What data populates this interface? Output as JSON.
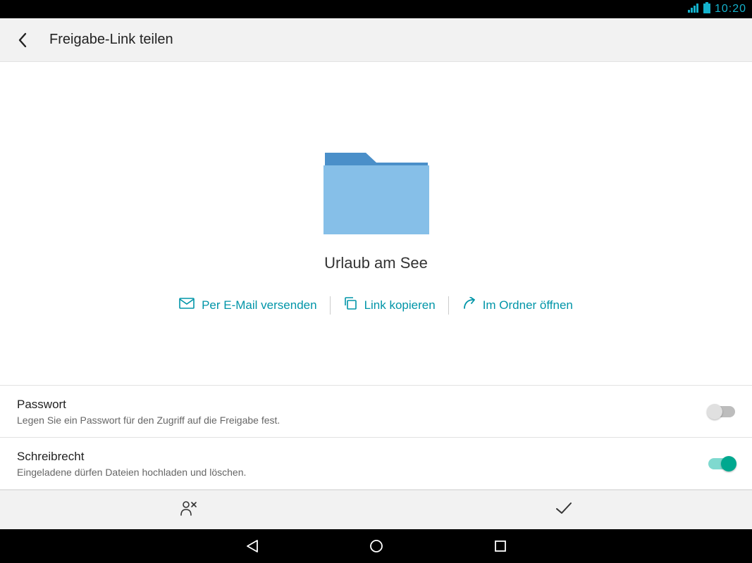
{
  "status": {
    "time": "10:20"
  },
  "appbar": {
    "title": "Freigabe-Link teilen"
  },
  "folder": {
    "name": "Urlaub am See"
  },
  "actions": {
    "email": "Per E-Mail versenden",
    "copy": "Link kopieren",
    "open": "Im Ordner öffnen"
  },
  "settings": {
    "password": {
      "title": "Passwort",
      "sub": "Legen Sie ein Passwort für den Zugriff auf die Freigabe fest.",
      "on": false
    },
    "write": {
      "title": "Schreibrecht",
      "sub": "Eingeladene dürfen Dateien hochladen und löschen.",
      "on": true
    }
  }
}
